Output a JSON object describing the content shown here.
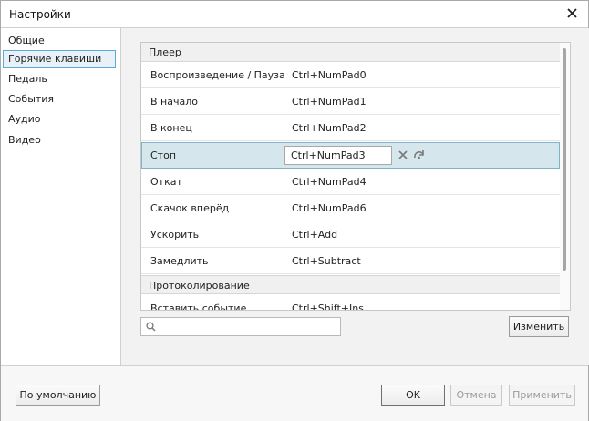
{
  "window": {
    "title": "Настройки"
  },
  "sidebar": {
    "items": [
      {
        "label": "Общие"
      },
      {
        "label": "Горячие клавиши"
      },
      {
        "label": "Педаль"
      },
      {
        "label": "События"
      },
      {
        "label": "Аудио"
      },
      {
        "label": "Видео"
      }
    ],
    "selected": "Горячие клавиши"
  },
  "hotkeys": {
    "groups": [
      {
        "name": "Плеер",
        "rows": [
          {
            "action": "Воспроизведение / Пауза",
            "keys": "Ctrl+NumPad0"
          },
          {
            "action": "В начало",
            "keys": "Ctrl+NumPad1"
          },
          {
            "action": "В конец",
            "keys": "Ctrl+NumPad2"
          },
          {
            "action": "Стоп",
            "keys": "Ctrl+NumPad3"
          },
          {
            "action": "Откат",
            "keys": "Ctrl+NumPad4"
          },
          {
            "action": "Скачок вперёд",
            "keys": "Ctrl+NumPad6"
          },
          {
            "action": "Ускорить",
            "keys": "Ctrl+Add"
          },
          {
            "action": "Замедлить",
            "keys": "Ctrl+Subtract"
          }
        ]
      },
      {
        "name": "Протоколирование",
        "rows": [
          {
            "action": "Вставить событие",
            "keys": "Ctrl+Shift+Ins"
          }
        ]
      }
    ],
    "selected_action": "Стоп"
  },
  "search": {
    "value": "",
    "placeholder": ""
  },
  "buttons": {
    "change": "Изменить",
    "defaults": "По умолчанию",
    "ok": "OK",
    "cancel": "Отмена",
    "apply": "Применить"
  },
  "colors": {
    "selection_bg": "#d5e6ec",
    "selection_border": "#7fb4c8",
    "sidebar_selected_border": "#5fa8d3"
  }
}
